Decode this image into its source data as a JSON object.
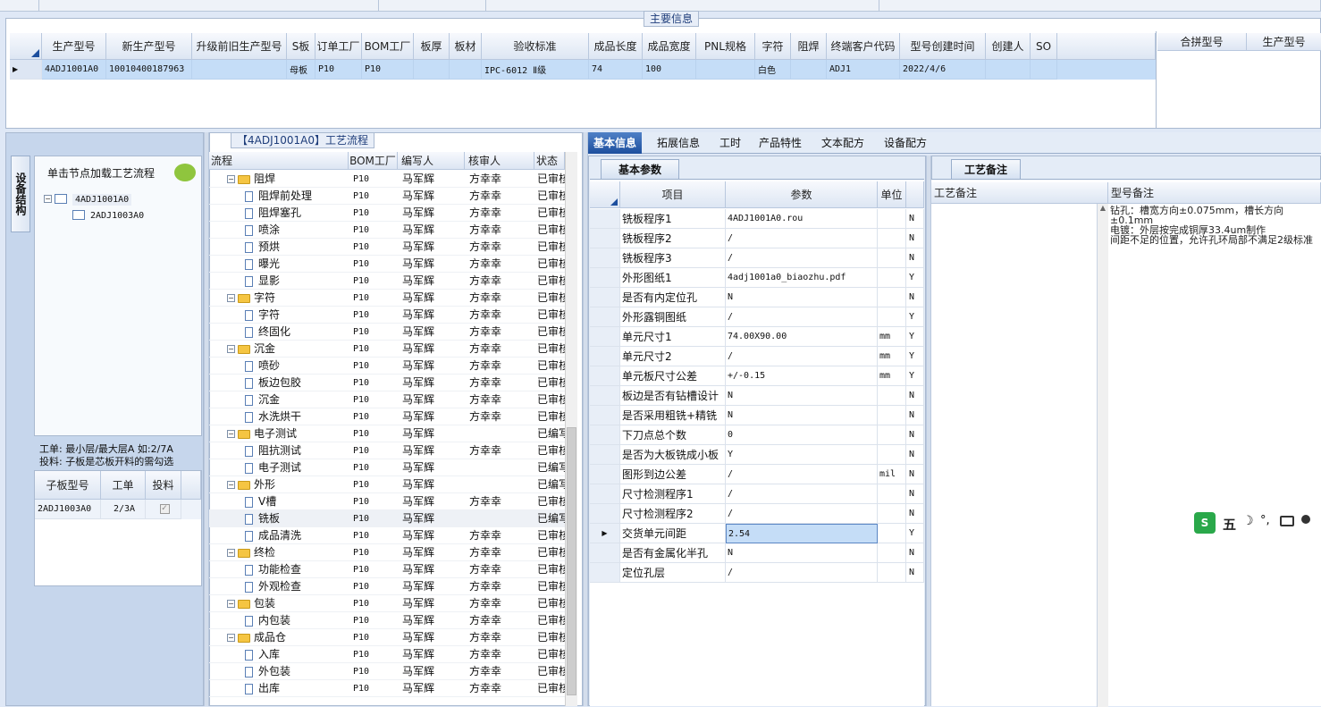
{
  "main_info": {
    "legend": "主要信息",
    "columns": [
      "生产型号",
      "新生产型号",
      "升级前旧生产型号",
      "S板",
      "订单工厂",
      "BOM工厂",
      "板厚",
      "板材",
      "验收标准",
      "成品长度",
      "成品宽度",
      "PNL规格",
      "字符",
      "阻焊",
      "终端客户代码",
      "型号创建时间",
      "创建人",
      "SO"
    ],
    "row": [
      "4ADJ1001A0",
      "10010400187963",
      "",
      "母板",
      "P10",
      "P10",
      "",
      "",
      "IPC-6012 Ⅱ级",
      "74",
      "100",
      "",
      "白色",
      "",
      "ADJ1",
      "2022/4/6",
      "",
      ""
    ],
    "right_columns": [
      "合拼型号",
      "生产型号"
    ]
  },
  "left_panel": {
    "side_tab": "设备结构",
    "header": "单击节点加载工艺流程",
    "tree": [
      {
        "label": "4ADJ1001A0",
        "level": 0
      },
      {
        "label": "2ADJ1003A0",
        "level": 1
      }
    ],
    "note_line1": "工单: 最小层/最大层A 如:2/7A",
    "note_line2": "投料: 子板是芯板开料的需勾选",
    "sub_columns": [
      "子板型号",
      "工单",
      "投料"
    ],
    "sub_rows": [
      {
        "model": "2ADJ1003A0",
        "order": "2/3A",
        "checked": true
      }
    ]
  },
  "flow": {
    "title": "【4ADJ1001A0】工艺流程",
    "columns": [
      "流程",
      "BOM工厂",
      "编写人",
      "核审人",
      "状态"
    ],
    "rows": [
      {
        "name": "阻焊",
        "folder": true,
        "bom": "P10",
        "writer": "马军辉",
        "reviewer": "方幸幸",
        "status": "已审核"
      },
      {
        "name": "阻焊前处理",
        "folder": false,
        "bom": "P10",
        "writer": "马军辉",
        "reviewer": "方幸幸",
        "status": "已审核"
      },
      {
        "name": "阻焊塞孔",
        "folder": false,
        "bom": "P10",
        "writer": "马军辉",
        "reviewer": "方幸幸",
        "status": "已审核"
      },
      {
        "name": "喷涂",
        "folder": false,
        "bom": "P10",
        "writer": "马军辉",
        "reviewer": "方幸幸",
        "status": "已审核"
      },
      {
        "name": "预烘",
        "folder": false,
        "bom": "P10",
        "writer": "马军辉",
        "reviewer": "方幸幸",
        "status": "已审核"
      },
      {
        "name": "曝光",
        "folder": false,
        "bom": "P10",
        "writer": "马军辉",
        "reviewer": "方幸幸",
        "status": "已审核"
      },
      {
        "name": "显影",
        "folder": false,
        "bom": "P10",
        "writer": "马军辉",
        "reviewer": "方幸幸",
        "status": "已审核"
      },
      {
        "name": "字符",
        "folder": true,
        "bom": "P10",
        "writer": "马军辉",
        "reviewer": "方幸幸",
        "status": "已审核"
      },
      {
        "name": "字符",
        "folder": false,
        "bom": "P10",
        "writer": "马军辉",
        "reviewer": "方幸幸",
        "status": "已审核"
      },
      {
        "name": "终固化",
        "folder": false,
        "bom": "P10",
        "writer": "马军辉",
        "reviewer": "方幸幸",
        "status": "已审核"
      },
      {
        "name": "沉金",
        "folder": true,
        "bom": "P10",
        "writer": "马军辉",
        "reviewer": "方幸幸",
        "status": "已审核"
      },
      {
        "name": "喷砂",
        "folder": false,
        "bom": "P10",
        "writer": "马军辉",
        "reviewer": "方幸幸",
        "status": "已审核"
      },
      {
        "name": "板边包胶",
        "folder": false,
        "bom": "P10",
        "writer": "马军辉",
        "reviewer": "方幸幸",
        "status": "已审核"
      },
      {
        "name": "沉金",
        "folder": false,
        "bom": "P10",
        "writer": "马军辉",
        "reviewer": "方幸幸",
        "status": "已审核"
      },
      {
        "name": "水洗烘干",
        "folder": false,
        "bom": "P10",
        "writer": "马军辉",
        "reviewer": "方幸幸",
        "status": "已审核"
      },
      {
        "name": "电子测试",
        "folder": true,
        "bom": "P10",
        "writer": "马军辉",
        "reviewer": "",
        "status": "已编写"
      },
      {
        "name": "阻抗测试",
        "folder": false,
        "bom": "P10",
        "writer": "马军辉",
        "reviewer": "方幸幸",
        "status": "已审核"
      },
      {
        "name": "电子测试",
        "folder": false,
        "bom": "P10",
        "writer": "马军辉",
        "reviewer": "",
        "status": "已编写"
      },
      {
        "name": "外形",
        "folder": true,
        "bom": "P10",
        "writer": "马军辉",
        "reviewer": "",
        "status": "已编写"
      },
      {
        "name": "V槽",
        "folder": false,
        "bom": "P10",
        "writer": "马军辉",
        "reviewer": "方幸幸",
        "status": "已审核"
      },
      {
        "name": "铣板",
        "folder": false,
        "bom": "P10",
        "writer": "马军辉",
        "reviewer": "",
        "status": "已编写"
      },
      {
        "name": "成品清洗",
        "folder": false,
        "bom": "P10",
        "writer": "马军辉",
        "reviewer": "方幸幸",
        "status": "已审核"
      },
      {
        "name": "终检",
        "folder": true,
        "bom": "P10",
        "writer": "马军辉",
        "reviewer": "方幸幸",
        "status": "已审核"
      },
      {
        "name": "功能检查",
        "folder": false,
        "bom": "P10",
        "writer": "马军辉",
        "reviewer": "方幸幸",
        "status": "已审核"
      },
      {
        "name": "外观检查",
        "folder": false,
        "bom": "P10",
        "writer": "马军辉",
        "reviewer": "方幸幸",
        "status": "已审核"
      },
      {
        "name": "包装",
        "folder": true,
        "bom": "P10",
        "writer": "马军辉",
        "reviewer": "方幸幸",
        "status": "已审核"
      },
      {
        "name": "内包装",
        "folder": false,
        "bom": "P10",
        "writer": "马军辉",
        "reviewer": "方幸幸",
        "status": "已审核"
      },
      {
        "name": "成品仓",
        "folder": true,
        "bom": "P10",
        "writer": "马军辉",
        "reviewer": "方幸幸",
        "status": "已审核"
      },
      {
        "name": "入库",
        "folder": false,
        "bom": "P10",
        "writer": "马军辉",
        "reviewer": "方幸幸",
        "status": "已审核"
      },
      {
        "name": "外包装",
        "folder": false,
        "bom": "P10",
        "writer": "马军辉",
        "reviewer": "方幸幸",
        "status": "已审核"
      },
      {
        "name": "出库",
        "folder": false,
        "bom": "P10",
        "writer": "马军辉",
        "reviewer": "方幸幸",
        "status": "已审核"
      }
    ]
  },
  "tabs": [
    "基本信息",
    "拓展信息",
    "工时",
    "产品特性",
    "文本配方",
    "设备配方"
  ],
  "basic_params": {
    "subtab": "基本参数",
    "columns": [
      "项目",
      "参数",
      "单位"
    ],
    "rows": [
      {
        "item": "铣板程序1",
        "value": "4ADJ1001A0.rou",
        "unit": "",
        "flag": "N"
      },
      {
        "item": "铣板程序2",
        "value": "/",
        "unit": "",
        "flag": "N"
      },
      {
        "item": "铣板程序3",
        "value": "/",
        "unit": "",
        "flag": "N"
      },
      {
        "item": "外形图纸1",
        "value": "4adj1001a0_biaozhu.pdf",
        "unit": "",
        "flag": "Y"
      },
      {
        "item": "是否有内定位孔",
        "value": "N",
        "unit": "",
        "flag": "N"
      },
      {
        "item": "外形露铜图纸",
        "value": "/",
        "unit": "",
        "flag": "Y"
      },
      {
        "item": "单元尺寸1",
        "value": "74.00X90.00",
        "unit": "mm",
        "flag": "Y"
      },
      {
        "item": "单元尺寸2",
        "value": "/",
        "unit": "mm",
        "flag": "Y"
      },
      {
        "item": "单元板尺寸公差",
        "value": "+/-0.15",
        "unit": "mm",
        "flag": "Y"
      },
      {
        "item": "板边是否有钻槽设计",
        "value": "N",
        "unit": "",
        "flag": "N"
      },
      {
        "item": "是否采用粗铣+精铣",
        "value": "N",
        "unit": "",
        "flag": "N"
      },
      {
        "item": "下刀点总个数",
        "value": "0",
        "unit": "",
        "flag": "N"
      },
      {
        "item": "是否为大板铣成小板",
        "value": "Y",
        "unit": "",
        "flag": "N"
      },
      {
        "item": "图形到边公差",
        "value": "/",
        "unit": "mil",
        "flag": "N"
      },
      {
        "item": "尺寸检测程序1",
        "value": "/",
        "unit": "",
        "flag": "N"
      },
      {
        "item": "尺寸检测程序2",
        "value": "/",
        "unit": "",
        "flag": "N"
      },
      {
        "item": "交货单元间距",
        "value": "2.54",
        "unit": "",
        "flag": "Y"
      },
      {
        "item": "是否有金属化半孔",
        "value": "N",
        "unit": "",
        "flag": "N"
      },
      {
        "item": "定位孔层",
        "value": "/",
        "unit": "",
        "flag": "N"
      }
    ]
  },
  "process_notes": {
    "subtab": "工艺备注",
    "col1": "工艺备注",
    "col2": "型号备注",
    "model_note_lines": [
      "钻孔：槽宽方向±0.075mm，槽长方向±0.1mm",
      "电镀：外层按完成铜厚33.4um制作",
      "间距不足的位置，允许孔环局部不满足2级标准"
    ]
  },
  "ime": {
    "label": "五"
  }
}
